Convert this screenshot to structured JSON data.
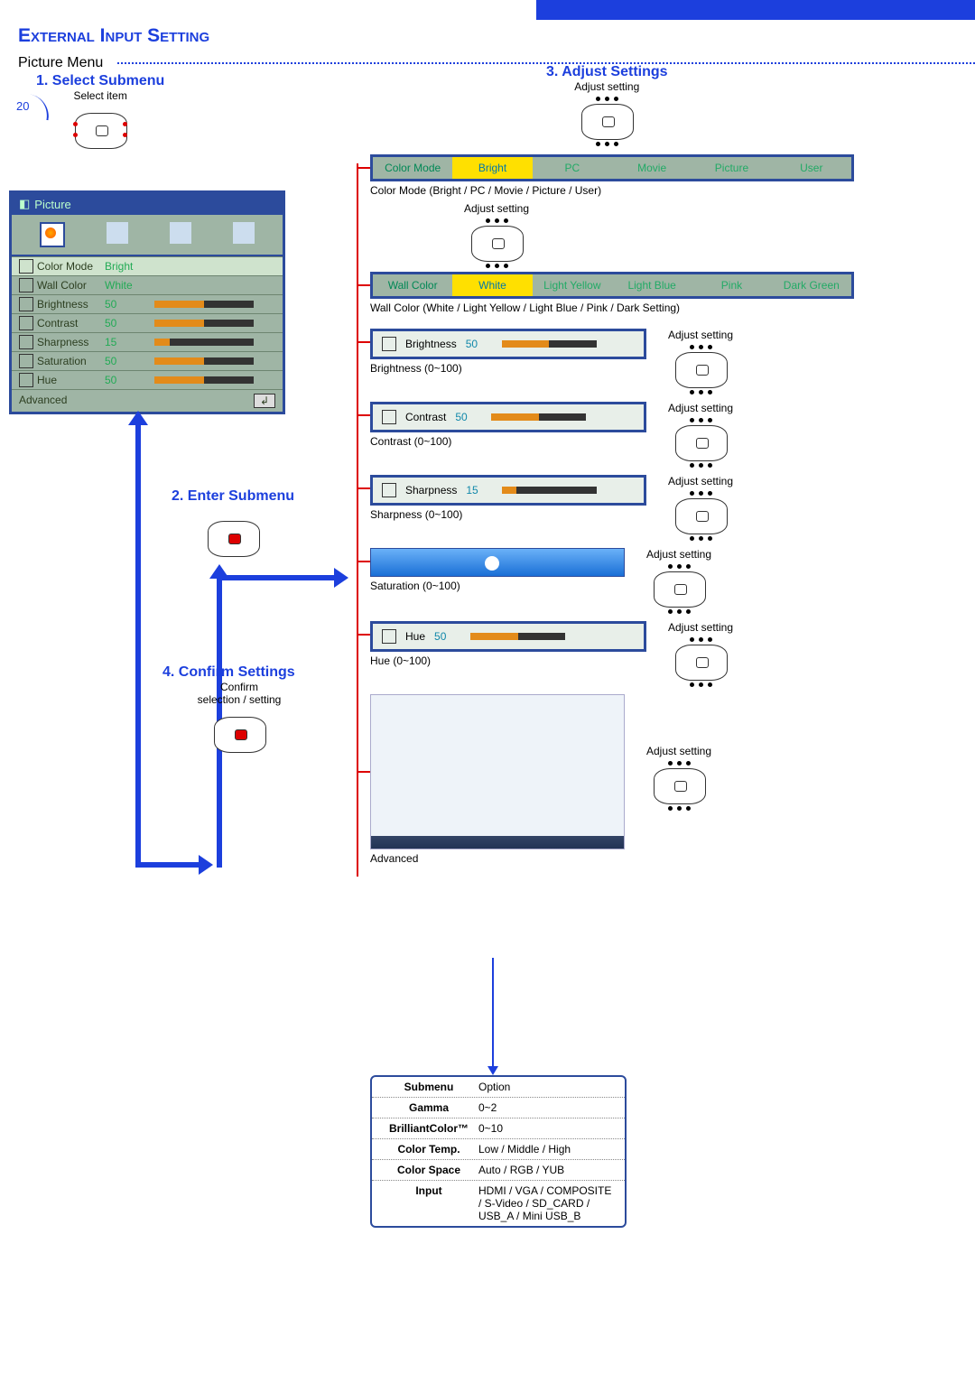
{
  "header": {
    "title": "External Input Setting"
  },
  "section": "Picture Menu",
  "steps": {
    "s1": {
      "title": "1. Select Submenu",
      "hint": "Select item"
    },
    "s2": {
      "title": "2. Enter Submenu"
    },
    "s3": {
      "title": "3. Adjust Settings",
      "hint": "Adjust setting"
    },
    "s4": {
      "title": "4. Confirm Settings",
      "hint1": "Confirm",
      "hint2": "selection / setting"
    }
  },
  "adjust_label": "Adjust setting",
  "osd_main": {
    "title": "Picture",
    "rows": [
      {
        "label": "Color Mode",
        "value": "Bright",
        "slider": null
      },
      {
        "label": "Wall Color",
        "value": "White",
        "slider": null
      },
      {
        "label": "Brightness",
        "value": "50",
        "slider": 50
      },
      {
        "label": "Contrast",
        "value": "50",
        "slider": 50
      },
      {
        "label": "Sharpness",
        "value": "15",
        "slider": 15
      },
      {
        "label": "Saturation",
        "value": "50",
        "slider": 50
      },
      {
        "label": "Hue",
        "value": "50",
        "slider": 50
      }
    ],
    "footer": "Advanced"
  },
  "settings": {
    "color_mode": {
      "label": "Color Mode",
      "options": [
        "Bright",
        "PC",
        "Movie",
        "Picture",
        "User"
      ],
      "selected": "Bright",
      "caption": "Color Mode (Bright / PC / Movie / Picture / User)"
    },
    "wall_color": {
      "label": "Wall Color",
      "options": [
        "White",
        "Light Yellow",
        "Light Blue",
        "Pink",
        "Dark Green"
      ],
      "selected": "White",
      "caption": "Wall Color (White / Light Yellow / Light Blue / Pink / Dark Setting)"
    },
    "brightness": {
      "label": "Brightness",
      "value": "50",
      "pct": 50,
      "caption": "Brightness (0~100)"
    },
    "contrast": {
      "label": "Contrast",
      "value": "50",
      "pct": 50,
      "caption": "Contrast (0~100)"
    },
    "sharpness": {
      "label": "Sharpness",
      "value": "15",
      "pct": 15,
      "caption": "Sharpness (0~100)"
    },
    "saturation": {
      "caption": "Saturation (0~100)"
    },
    "hue": {
      "label": "Hue",
      "value": "50",
      "pct": 50,
      "caption": "Hue (0~100)"
    },
    "advanced_caption": "Advanced"
  },
  "advanced_table": {
    "header": {
      "left": "Submenu",
      "right": "Option"
    },
    "rows": [
      {
        "label": "Gamma",
        "value": "0~2"
      },
      {
        "label": "BrilliantColor™",
        "value": "0~10"
      },
      {
        "label": "Color Temp.",
        "value": "Low / Middle / High"
      },
      {
        "label": "Color Space",
        "value": "Auto / RGB / YUB"
      },
      {
        "label": "Input",
        "value": "HDMI / VGA / COMPOSITE / S-Video / SD_CARD / USB_A / Mini USB_B"
      }
    ]
  },
  "page_number": "20"
}
